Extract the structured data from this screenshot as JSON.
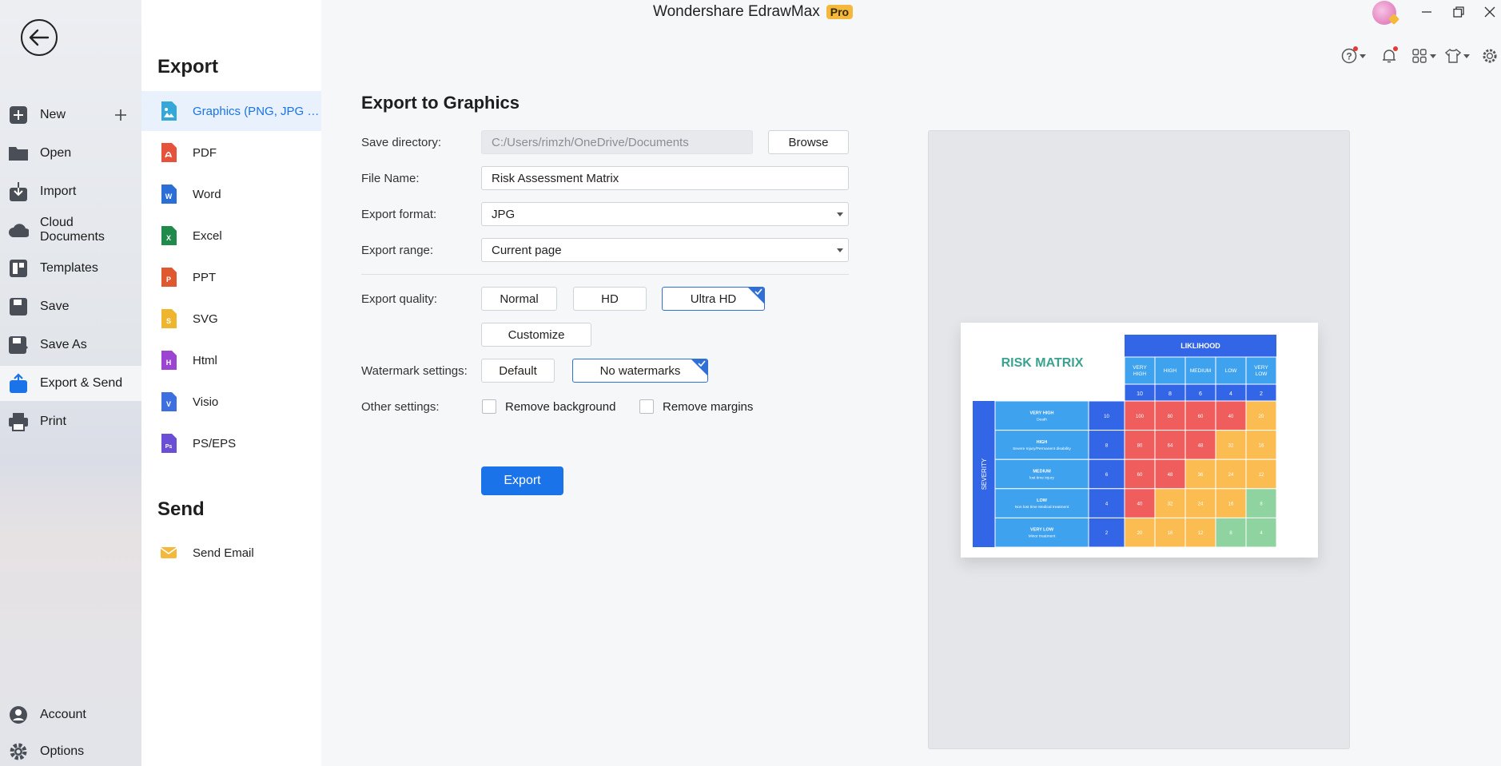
{
  "app": {
    "title": "Wondershare EdrawMax",
    "badge": "Pro"
  },
  "sidebar": {
    "items": [
      {
        "label": "New",
        "icon": "new-icon"
      },
      {
        "label": "Open",
        "icon": "folder-icon"
      },
      {
        "label": "Import",
        "icon": "import-icon"
      },
      {
        "label": "Cloud Documents",
        "icon": "cloud-icon"
      },
      {
        "label": "Templates",
        "icon": "templates-icon"
      },
      {
        "label": "Save",
        "icon": "save-icon"
      },
      {
        "label": "Save As",
        "icon": "save-as-icon"
      },
      {
        "label": "Export & Send",
        "icon": "export-icon",
        "active": true
      },
      {
        "label": "Print",
        "icon": "print-icon"
      }
    ],
    "bottom": [
      {
        "label": "Account",
        "icon": "account-icon"
      },
      {
        "label": "Options",
        "icon": "gear-icon"
      }
    ]
  },
  "export_menu": {
    "heading": "Export",
    "items": [
      {
        "label": "Graphics (PNG, JPG et...",
        "icon": "graphics-icon",
        "color": "#34a9d9",
        "active": true
      },
      {
        "label": "PDF",
        "icon": "pdf-icon",
        "color": "#e5533d"
      },
      {
        "label": "Word",
        "icon": "word-icon",
        "color": "#2b6fd6",
        "glyph": "W"
      },
      {
        "label": "Excel",
        "icon": "excel-icon",
        "color": "#1f8a4c",
        "glyph": "X"
      },
      {
        "label": "PPT",
        "icon": "ppt-icon",
        "color": "#e0582f",
        "glyph": "P"
      },
      {
        "label": "SVG",
        "icon": "svg-icon",
        "color": "#f0b52e",
        "glyph": "S"
      },
      {
        "label": "Html",
        "icon": "html-icon",
        "color": "#9b45d1",
        "glyph": "H"
      },
      {
        "label": "Visio",
        "icon": "visio-icon",
        "color": "#3d6fe0",
        "glyph": "V"
      },
      {
        "label": "PS/EPS",
        "icon": "ps-eps-icon",
        "color": "#6a4fd6",
        "glyph": "Ps"
      }
    ],
    "send_heading": "Send",
    "send_items": [
      {
        "label": "Send Email",
        "icon": "email-icon",
        "color": "#f4b93c"
      }
    ]
  },
  "panel": {
    "title": "Export to Graphics",
    "save_directory": {
      "label": "Save directory:",
      "value": "C:/Users/rimzh/OneDrive/Documents",
      "browse": "Browse"
    },
    "file_name": {
      "label": "File Name:",
      "value": "Risk Assessment Matrix"
    },
    "export_format": {
      "label": "Export format:",
      "value": "JPG"
    },
    "export_range": {
      "label": "Export range:",
      "value": "Current page"
    },
    "quality": {
      "label": "Export quality:",
      "options": [
        "Normal",
        "HD",
        "Ultra HD"
      ],
      "selected": "Ultra HD",
      "customize": "Customize"
    },
    "watermark": {
      "label": "Watermark settings:",
      "options": [
        "Default",
        "No watermarks"
      ],
      "selected": "No watermarks"
    },
    "other": {
      "label": "Other settings:",
      "remove_background": "Remove background",
      "remove_margins": "Remove margins"
    },
    "export_button": "Export"
  },
  "preview": {
    "title": "RISK MATRIX",
    "likelihood_label": "LIKLIHOOD",
    "severity_label": "SEVERITY",
    "likelihood_levels": [
      "VERY HIGH",
      "HIGH",
      "MEDIUM",
      "LOW",
      "VERY LOW"
    ],
    "likelihood_scores": [
      "10",
      "8",
      "6",
      "4",
      "2"
    ],
    "severity_levels": [
      {
        "name": "VERY HIGH",
        "desc": "Death",
        "score": "10"
      },
      {
        "name": "HIGH",
        "desc": "Severe Injury/Permanent disability",
        "score": "8"
      },
      {
        "name": "MEDIUM",
        "desc": "lost time Injury",
        "score": "6"
      },
      {
        "name": "LOW",
        "desc": "Non lost time Medical treatment",
        "score": "4"
      },
      {
        "name": "VERY LOW",
        "desc": "Minor treatment",
        "score": "2"
      }
    ],
    "matrix": [
      [
        "100",
        "80",
        "60",
        "40",
        "20"
      ],
      [
        "80",
        "64",
        "48",
        "32",
        "16"
      ],
      [
        "60",
        "48",
        "36",
        "24",
        "12"
      ],
      [
        "40",
        "32",
        "24",
        "16",
        "8"
      ],
      [
        "20",
        "16",
        "12",
        "8",
        "4"
      ]
    ],
    "colors": {
      "red": "#ef5d5d",
      "orange": "#fbbd52",
      "green": "#8fd3a0",
      "blue_dark": "#3366e6",
      "blue_light": "#3ea2ef",
      "title": "#3aa38f"
    }
  }
}
